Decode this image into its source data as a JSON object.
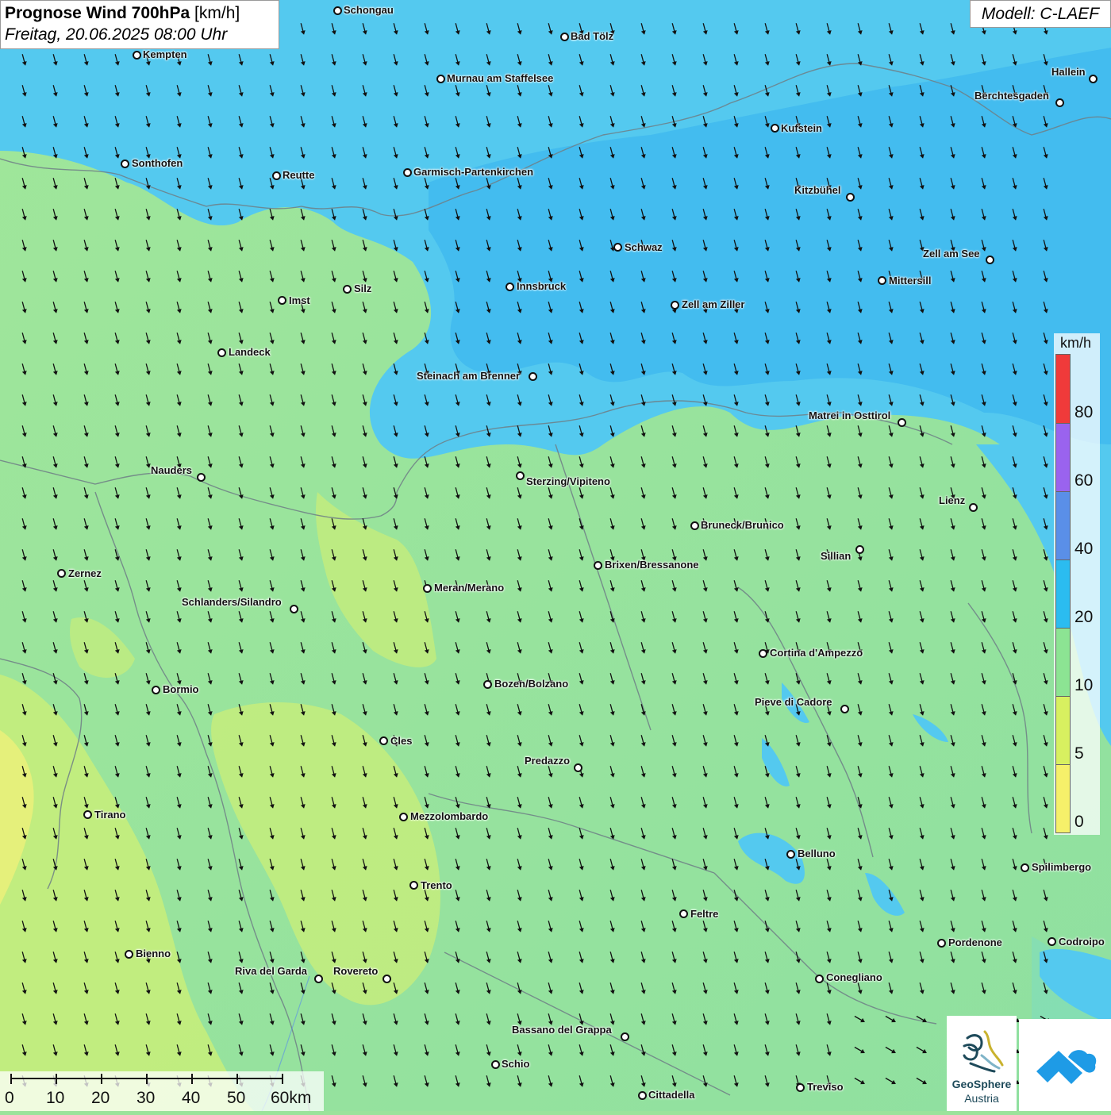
{
  "title": {
    "bold": "Prognose Wind 700hPa",
    "unit": "[km/h]",
    "date": "Freitag, 20.06.2025 08:00 Uhr"
  },
  "model": "Modell: C-LAEF",
  "legend": {
    "unit": "km/h",
    "ticks": [
      "80",
      "60",
      "40",
      "20",
      "10",
      "5",
      "0"
    ],
    "colors": {
      "above_80": "#f03a3a",
      "60_80": "#9a63ee",
      "40_60": "#5a8fe8",
      "20_40": "#2bbcf0",
      "10_20": "#8ce493",
      "5_10": "#d8f060",
      "0_5": "#f6f06a"
    }
  },
  "scale_bar": {
    "labels": [
      "0",
      "10",
      "20",
      "30",
      "40",
      "50",
      "60km"
    ]
  },
  "logos": {
    "geosphere_line1": "GeoSphere",
    "geosphere_line2": "Austria"
  },
  "cities": [
    {
      "name": "Schongau"
    },
    {
      "name": "Bad Tölz"
    },
    {
      "name": "Kempten"
    },
    {
      "name": "Murnau am Staffelsee"
    },
    {
      "name": "Hallein"
    },
    {
      "name": "Berchtesgaden"
    },
    {
      "name": "Kufstein"
    },
    {
      "name": "Sonthofen"
    },
    {
      "name": "Reutte"
    },
    {
      "name": "Garmisch-Partenkirchen"
    },
    {
      "name": "Kitzbühel"
    },
    {
      "name": "Schwaz"
    },
    {
      "name": "Zell am See"
    },
    {
      "name": "Innsbruck"
    },
    {
      "name": "Mittersill"
    },
    {
      "name": "Silz"
    },
    {
      "name": "Imst"
    },
    {
      "name": "Zell am Ziller"
    },
    {
      "name": "Landeck"
    },
    {
      "name": "Steinach am Brenner"
    },
    {
      "name": "Matrei in Osttirol"
    },
    {
      "name": "Nauders"
    },
    {
      "name": "Sterzing/Vipiteno"
    },
    {
      "name": "Lienz"
    },
    {
      "name": "Bruneck/Brunico"
    },
    {
      "name": "Sillian"
    },
    {
      "name": "Brixen/Bressanone"
    },
    {
      "name": "Zernez"
    },
    {
      "name": "Meran/Merano"
    },
    {
      "name": "Schlanders/Silandro"
    },
    {
      "name": "Cortina d'Ampezzo"
    },
    {
      "name": "Bozen/Bolzano"
    },
    {
      "name": "Bormio"
    },
    {
      "name": "Pieve di Cadore"
    },
    {
      "name": "Cles"
    },
    {
      "name": "Predazzo"
    },
    {
      "name": "Tirano"
    },
    {
      "name": "Mezzolombardo"
    },
    {
      "name": "Belluno"
    },
    {
      "name": "Spilimbergo"
    },
    {
      "name": "Trento"
    },
    {
      "name": "Feltre"
    },
    {
      "name": "Pordenone"
    },
    {
      "name": "Codroipo"
    },
    {
      "name": "Bienno"
    },
    {
      "name": "Riva del Garda"
    },
    {
      "name": "Rovereto"
    },
    {
      "name": "Conegliano"
    },
    {
      "name": "Bassano del Grappa"
    },
    {
      "name": "Schio"
    },
    {
      "name": "Treviso"
    },
    {
      "name": "Cittadella"
    }
  ]
}
